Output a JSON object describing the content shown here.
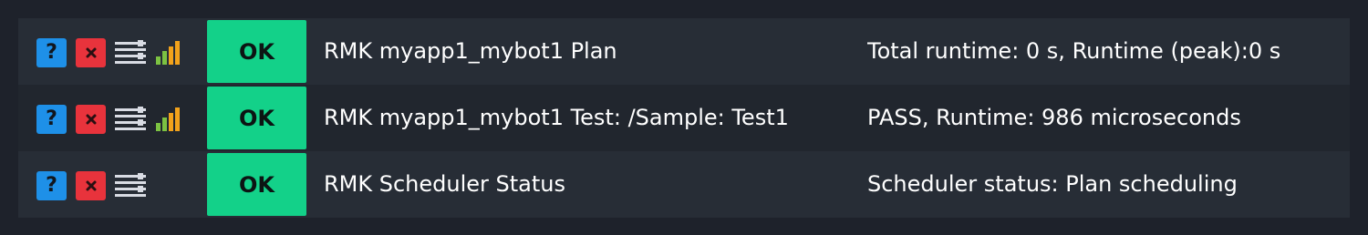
{
  "colors": {
    "page_bg": "#1e222b",
    "row_odd": "#272d36",
    "row_even": "#21262e",
    "state_ok": "#13d189",
    "help_blue": "#1e90e8",
    "remove_red": "#e8333c",
    "perf_green": "#7cc242",
    "perf_orange": "#f2a21b",
    "menu_gray": "#d9dce4"
  },
  "icons": {
    "help": "help-icon",
    "remove": "close-icon",
    "menu": "hamburger-menu-icon",
    "perf": "performance-bars-icon"
  },
  "help_symbol": "?",
  "rows": [
    {
      "state": "OK",
      "service": "RMK myapp1_mybot1 Plan",
      "output": "Total runtime: 0 s, Runtime (peak):0 s",
      "has_perf": true
    },
    {
      "state": "OK",
      "service": "RMK myapp1_mybot1 Test: /Sample: Test1",
      "output": "PASS, Runtime: 986 microseconds",
      "has_perf": true
    },
    {
      "state": "OK",
      "service": "RMK Scheduler Status",
      "output": "Scheduler status: Plan scheduling",
      "has_perf": false
    }
  ]
}
